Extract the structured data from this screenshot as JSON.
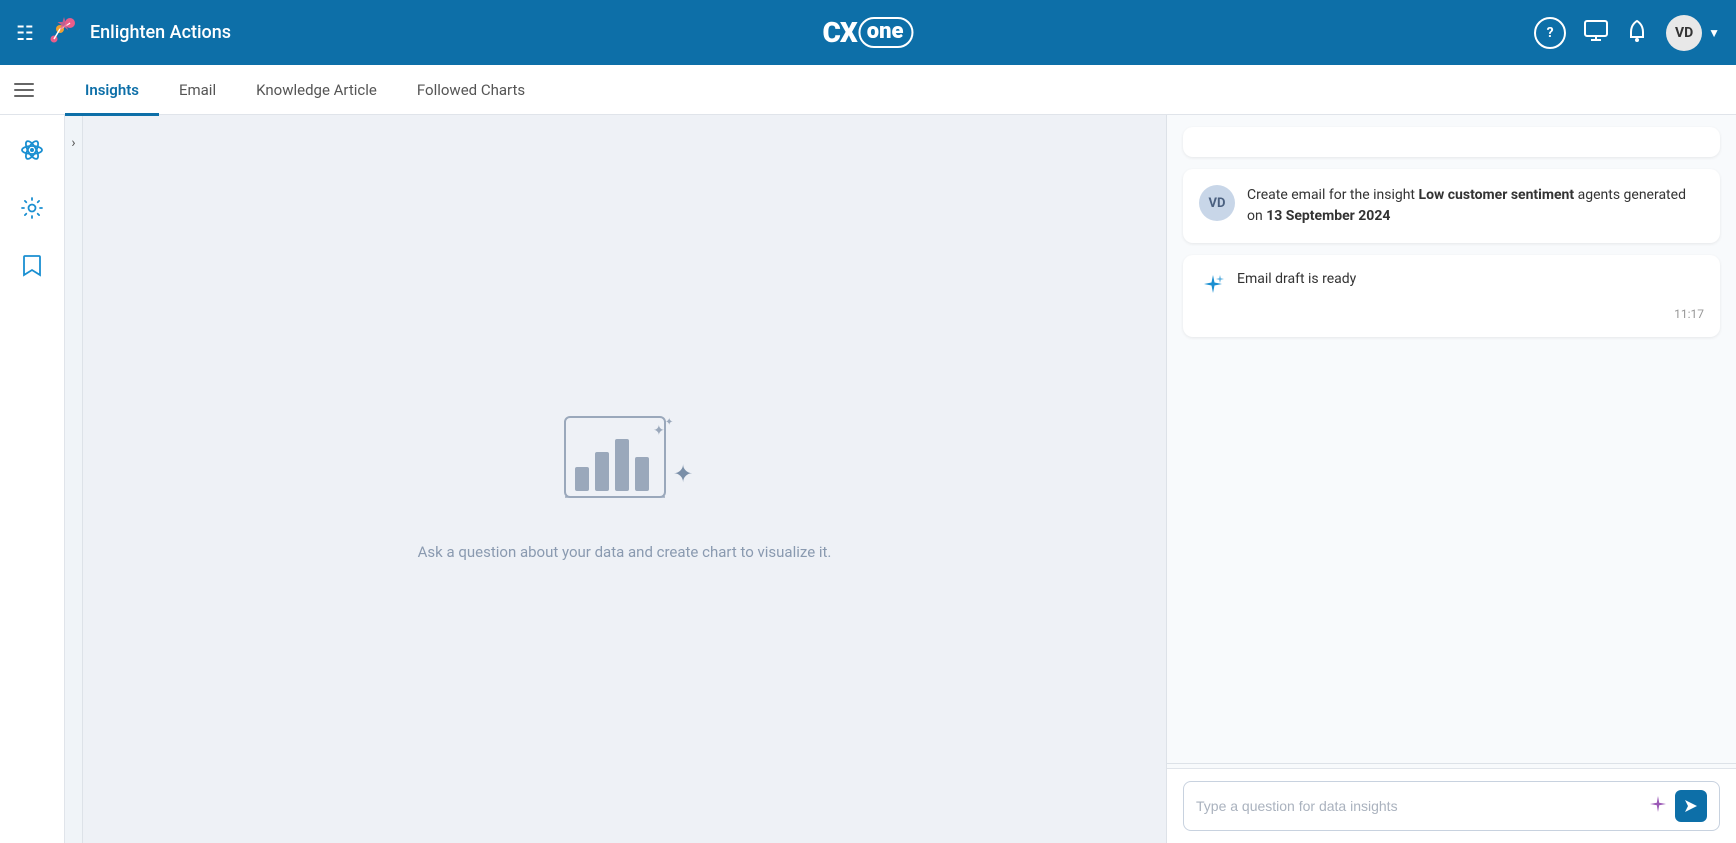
{
  "topbar": {
    "app_name": "Enlighten Actions",
    "logo_text": "CX",
    "logo_cloud": "one",
    "icons": {
      "help": "?",
      "monitor": "🖥",
      "bell": "🔔",
      "avatar_initials": "VD"
    }
  },
  "secondary_nav": {
    "tabs": [
      {
        "id": "insights",
        "label": "Insights",
        "active": true
      },
      {
        "id": "email",
        "label": "Email",
        "active": false
      },
      {
        "id": "knowledge-article",
        "label": "Knowledge Article",
        "active": false
      },
      {
        "id": "followed-charts",
        "label": "Followed Charts",
        "active": false
      }
    ]
  },
  "sidebar": {
    "items": [
      {
        "id": "atom",
        "icon": "⚛",
        "label": "atom-icon"
      },
      {
        "id": "settings",
        "icon": "⚙",
        "label": "settings-icon"
      },
      {
        "id": "bookmark",
        "icon": "🔖",
        "label": "bookmark-icon"
      }
    ]
  },
  "center": {
    "empty_state_text": "Ask a question about your data and create chart to visualize it."
  },
  "chat": {
    "messages": [
      {
        "type": "user",
        "avatar": "VD",
        "text_prefix": "Create email for the insight ",
        "text_bold1": "Low customer sentiment",
        "text_middle": " agents",
        "text_suffix": " generated on ",
        "text_bold2": "13 September 2024"
      }
    ],
    "response": {
      "text": "Email draft is ready",
      "timestamp": "11:17"
    },
    "input_placeholder": "Type a question for data insights"
  }
}
